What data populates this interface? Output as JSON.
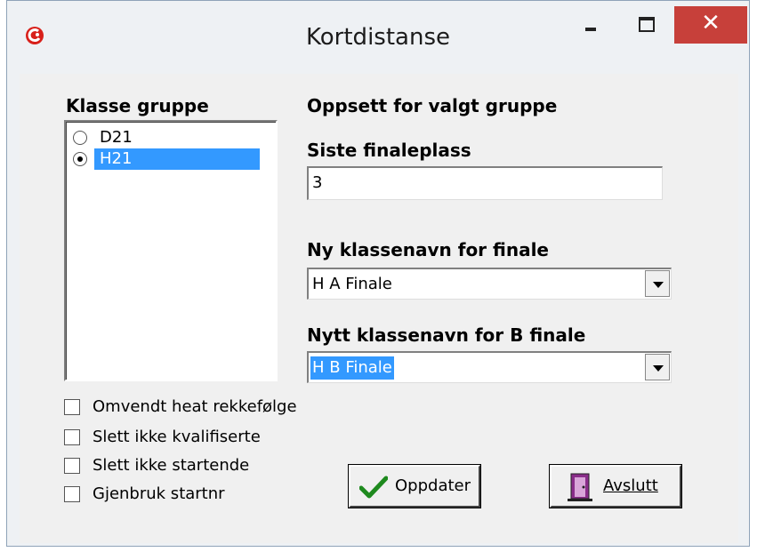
{
  "window": {
    "title": "Kortdistanse",
    "close_glyph": "✕"
  },
  "left": {
    "group_label": "Klasse gruppe",
    "items": [
      {
        "label": "D21",
        "selected": false
      },
      {
        "label": "H21",
        "selected": true
      }
    ]
  },
  "right": {
    "setup_label": "Oppsett for valgt gruppe",
    "last_place_label": "Siste finaleplass",
    "last_place_value": "3",
    "final_name_label": "Ny klassenavn for finale",
    "final_name_value": "H A Finale",
    "b_final_name_label": "Nytt klassenavn for B finale",
    "b_final_name_value": "H B Finale"
  },
  "checkboxes": [
    {
      "label": "Omvendt heat rekkefølge",
      "checked": false
    },
    {
      "label": "Slett ikke kvalifiserte",
      "checked": false
    },
    {
      "label": "Slett ikke startende",
      "checked": false
    },
    {
      "label": "Gjenbruk startnr",
      "checked": false
    }
  ],
  "buttons": {
    "update_label": "Oppdater",
    "exit_label": "Avslutt"
  },
  "icons": {
    "app": "app-logo-icon",
    "update": "checkmark-icon",
    "exit": "door-exit-icon"
  },
  "colors": {
    "selection": "#3399ff",
    "close": "#c7403a",
    "checkmark": "#1e8a1e"
  }
}
